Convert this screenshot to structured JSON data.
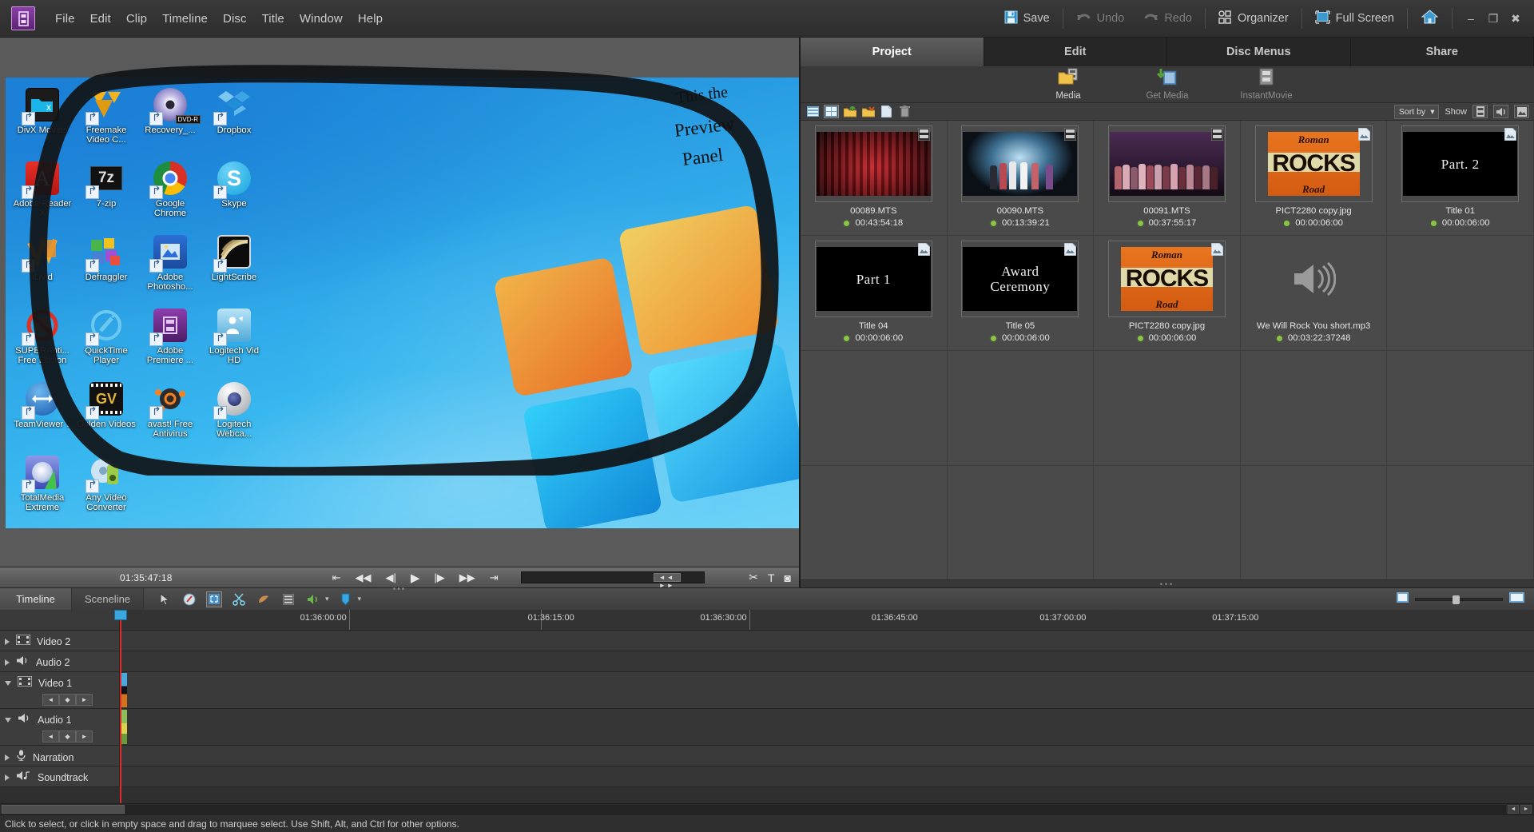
{
  "app": {
    "logo_icon": "film-strip-icon",
    "menus": [
      "File",
      "Edit",
      "Clip",
      "Timeline",
      "Disc",
      "Title",
      "Window",
      "Help"
    ]
  },
  "toolbar": {
    "save_label": "Save",
    "undo_label": "Undo",
    "redo_label": "Redo",
    "organizer_label": "Organizer",
    "fullscreen_label": "Full Screen",
    "home_icon": "home-icon",
    "minimize": "–",
    "maximize": "❐",
    "close": "✖"
  },
  "monitor": {
    "timecode": "01:35:47:18",
    "annotation_line1": "This the",
    "annotation_line2": "Preview",
    "annotation_line3": "Panel",
    "scrub_handle_label": "◄◄ ►►",
    "desktop_icons": [
      {
        "label": "DivX Movies",
        "icon": "divx-folder-icon"
      },
      {
        "label": "Freemake Video C...",
        "icon": "freemake-icon"
      },
      {
        "label": "Recovery_...",
        "icon": "dvd-disc-icon"
      },
      {
        "label": "Dropbox",
        "icon": "dropbox-icon"
      },
      {
        "label": "Adobe Reader X",
        "icon": "adobe-reader-icon"
      },
      {
        "label": "7-zip",
        "icon": "sevenzip-icon"
      },
      {
        "label": "Google Chrome",
        "icon": "chrome-icon"
      },
      {
        "label": "Skype",
        "icon": "skype-icon"
      },
      {
        "label": "iLivid",
        "icon": "ilivid-icon"
      },
      {
        "label": "Defraggler",
        "icon": "defraggler-icon"
      },
      {
        "label": "Adobe Photosho...",
        "icon": "photoshop-icon"
      },
      {
        "label": "LightScribe",
        "icon": "lightscribe-icon"
      },
      {
        "label": "SUPERAnti... Free Edition",
        "icon": "superantispyware-icon"
      },
      {
        "label": "QuickTime Player",
        "icon": "quicktime-icon"
      },
      {
        "label": "Adobe Premiere ...",
        "icon": "premiere-icon"
      },
      {
        "label": "Logitech Vid HD",
        "icon": "logitech-vid-icon"
      },
      {
        "label": "TeamViewer 7",
        "icon": "teamviewer-icon"
      },
      {
        "label": "Golden Videos",
        "icon": "golden-videos-icon"
      },
      {
        "label": "avast! Free Antivirus",
        "icon": "avast-icon"
      },
      {
        "label": "Logitech Webca...",
        "icon": "logitech-webcam-icon"
      },
      {
        "label": "TotalMedia Extreme",
        "icon": "totalmedia-icon"
      },
      {
        "label": "Any Video Converter",
        "icon": "anyvideo-icon"
      }
    ],
    "dvd_badge": "DVD-R"
  },
  "panel": {
    "tabs": [
      {
        "label": "Project",
        "active": true
      },
      {
        "label": "Edit",
        "active": false
      },
      {
        "label": "Disc Menus",
        "active": false
      },
      {
        "label": "Share",
        "active": false
      }
    ],
    "subtabs": [
      {
        "label": "Media",
        "icon": "media-folder-icon",
        "active": true
      },
      {
        "label": "Get Media",
        "icon": "get-media-icon",
        "active": false
      },
      {
        "label": "InstantMovie",
        "icon": "instantmovie-icon",
        "active": false
      }
    ],
    "media_toolbar": {
      "list_view_icon": "list-view-icon",
      "grid_view_icon": "grid-view-icon",
      "new_folder_icon": "new-folder-icon",
      "open_folder_icon": "open-folder-icon",
      "new_item_icon": "new-item-icon",
      "delete_icon": "trash-icon",
      "sort_by_label": "Sort by",
      "sort_caret": "▾",
      "show_label": "Show",
      "filter_video_icon": "video-filter-icon",
      "filter_audio_icon": "audio-filter-icon",
      "filter_image_icon": "image-filter-icon"
    },
    "media_items": [
      {
        "name": "00089.MTS",
        "duration": "00:43:54:18",
        "kind": "video",
        "art": "stage-red",
        "badge": "film-badge-icon"
      },
      {
        "name": "00090.MTS",
        "duration": "00:13:39:21",
        "kind": "video",
        "art": "stage-blue",
        "badge": "film-badge-icon"
      },
      {
        "name": "00091.MTS",
        "duration": "00:37:55:17",
        "kind": "video",
        "art": "stage-crowd",
        "badge": "film-badge-icon"
      },
      {
        "name": "PICT2280 copy.jpg",
        "duration": "00:00:06:00",
        "kind": "image",
        "art": "poster",
        "badge": "image-badge-icon"
      },
      {
        "name": "Title 01",
        "duration": "00:00:06:00",
        "kind": "title",
        "art": "title",
        "title_text": "Part. 2",
        "badge": "image-badge-icon"
      },
      {
        "name": "Title 04",
        "duration": "00:00:06:00",
        "kind": "title",
        "art": "title",
        "title_text": "Part 1",
        "badge": "image-badge-icon"
      },
      {
        "name": "Title 05",
        "duration": "00:00:06:00",
        "kind": "title",
        "art": "title",
        "title_text": "Award\nCeremony",
        "badge": "image-badge-icon"
      },
      {
        "name": "PICT2280 copy.jpg",
        "duration": "00:00:06:00",
        "kind": "image",
        "art": "poster",
        "badge": "image-badge-icon"
      },
      {
        "name": "We Will Rock You short.mp3",
        "duration": "00:03:22:37248",
        "kind": "audio",
        "art": "audio",
        "badge": ""
      }
    ],
    "poster_text": {
      "top": "Roman",
      "mid": "ROCKS",
      "bot": "Road"
    }
  },
  "timeline": {
    "tabs": [
      {
        "label": "Timeline",
        "active": true
      },
      {
        "label": "Sceneline",
        "active": false
      }
    ],
    "tools": [
      {
        "icon": "selection-tool-icon",
        "selected": false
      },
      {
        "icon": "clip-properties-icon",
        "selected": false
      },
      {
        "icon": "fit-to-window-icon",
        "selected": true
      },
      {
        "icon": "scissors-tool-icon",
        "selected": false
      },
      {
        "icon": "smart-mix-icon",
        "selected": false
      },
      {
        "icon": "track-list-icon",
        "selected": false
      },
      {
        "icon": "audio-meter-icon",
        "selected": false
      },
      {
        "icon": "marker-icon",
        "selected": false
      }
    ],
    "zoom_out_icon": "zoom-out-icon",
    "zoom_in_icon": "zoom-in-icon",
    "ruler_labels": [
      "01:36:00:00",
      "01:36:15:00",
      "01:36:30:00",
      "01:36:45:00",
      "01:37:00:00",
      "01:37:15:00"
    ],
    "tracks": [
      {
        "name": "Video 2",
        "icon": "video-track-icon",
        "expanded": false,
        "has_clip": false
      },
      {
        "name": "Audio 2",
        "icon": "audio-track-icon",
        "expanded": false,
        "has_clip": false
      },
      {
        "name": "Video 1",
        "icon": "video-track-icon",
        "expanded": true,
        "has_clip": true
      },
      {
        "name": "Audio 1",
        "icon": "audio-track-icon",
        "expanded": true,
        "has_clip": true
      },
      {
        "name": "Narration",
        "icon": "microphone-icon",
        "expanded": false,
        "has_clip": false
      },
      {
        "name": "Soundtrack",
        "icon": "soundtrack-icon",
        "expanded": false,
        "has_clip": false
      }
    ],
    "keyframe_nav": {
      "prev": "◄",
      "add": "◆",
      "next": "►"
    }
  },
  "status": {
    "message": "Click to select, or click in empty space and drag to marquee select. Use Shift, Alt, and Ctrl for other options."
  },
  "colors": {
    "accent_blue": "#3aa7e0",
    "playhead_red": "#e02b2b",
    "status_green": "#8bc34a",
    "panel_bg": "#383838"
  }
}
